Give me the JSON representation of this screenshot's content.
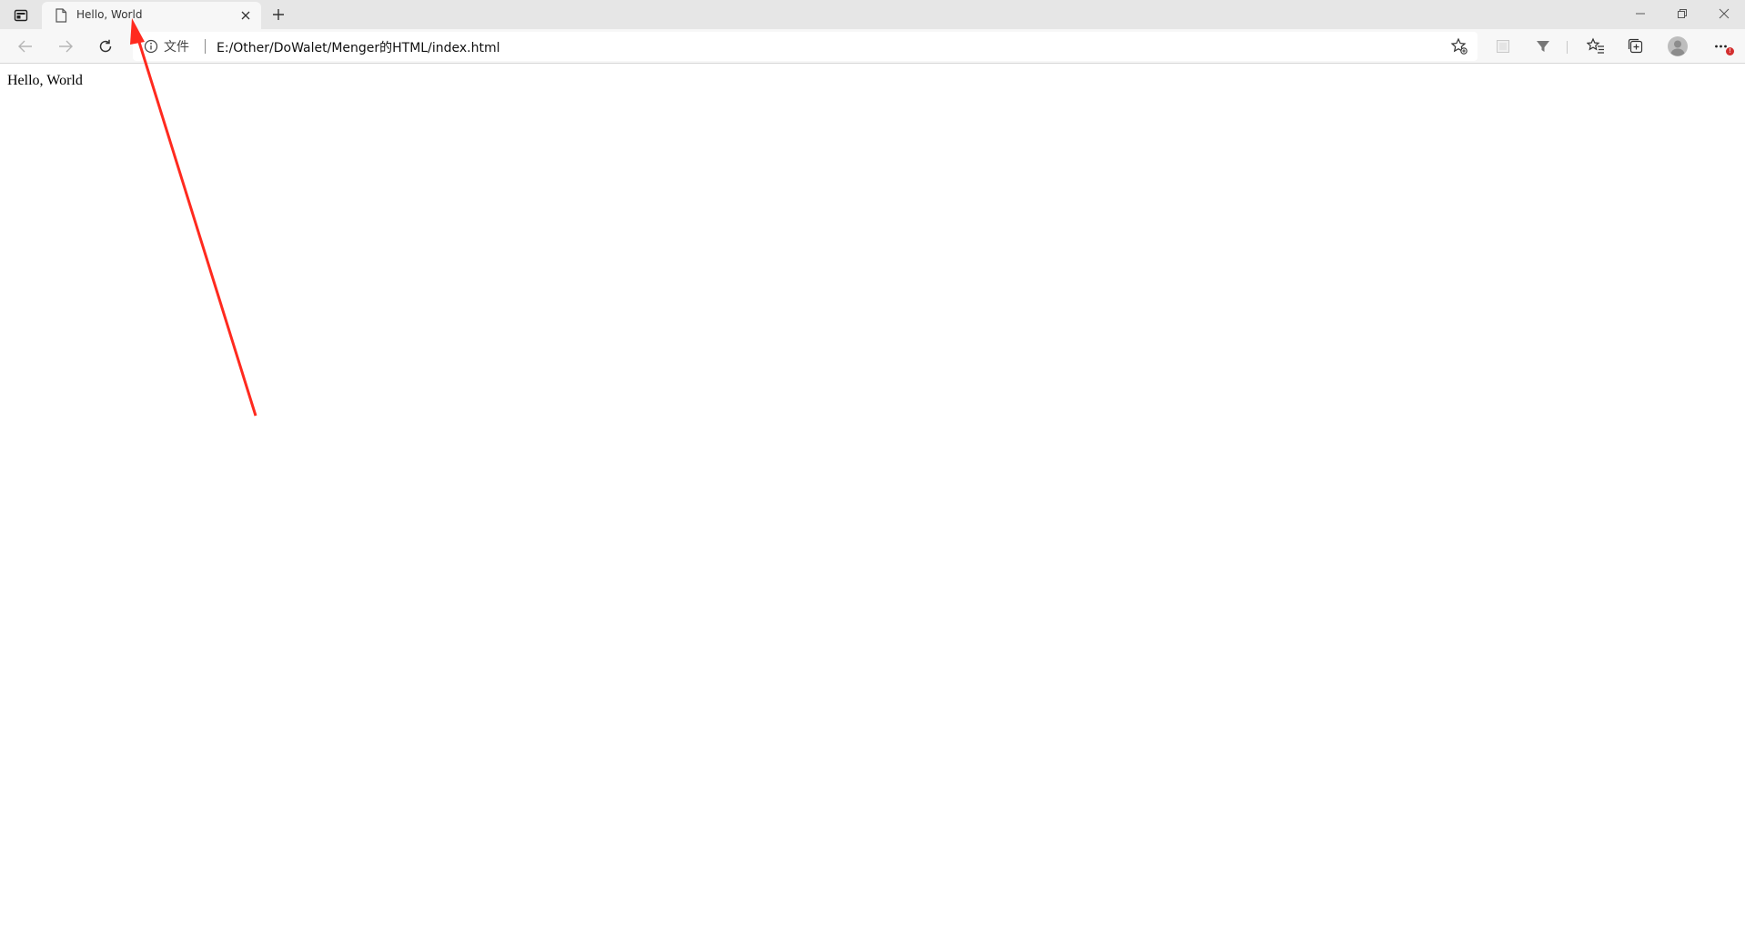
{
  "browser": {
    "tab": {
      "title": "Hello, World",
      "favicon": "document-icon",
      "close": "close-icon"
    },
    "new_tab": "plus-icon",
    "window_controls": [
      "minimize-icon",
      "restore-icon",
      "close-icon"
    ],
    "toolbar": {
      "back": "arrow-left-icon",
      "forward": "arrow-right-icon",
      "refresh": "refresh-icon",
      "site_info_label": "文件",
      "url": "E:/Other/DoWalet/Menger的HTML/index.html",
      "add_favorite": "star-add-icon",
      "extension_1": "extension-icon",
      "extension_2": "funnel-icon",
      "favorites": "favorites-icon",
      "collections": "collections-icon",
      "profile": "avatar-icon",
      "more": "more-icon",
      "more_badge": "!"
    }
  },
  "page": {
    "text": "Hello, World"
  },
  "colors": {
    "annotation_arrow": "#ff2a1f",
    "tabstrip": "#e6e6e6",
    "toolbar": "#f7f7f7"
  }
}
